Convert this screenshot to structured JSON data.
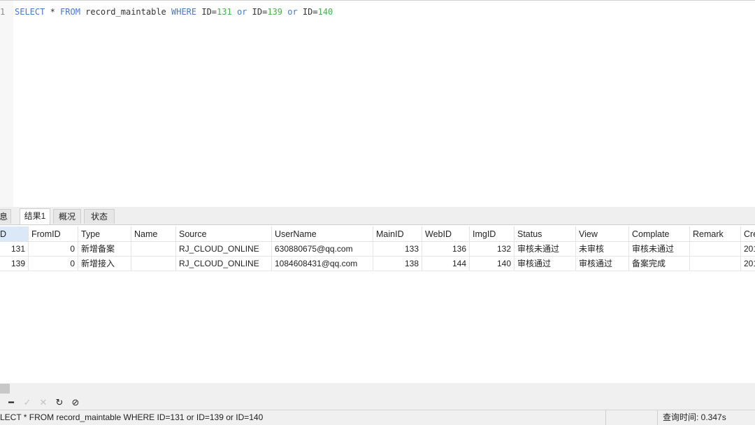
{
  "editor": {
    "line_number": "1",
    "sql": [
      {
        "text": "SELECT",
        "cls": "kw"
      },
      {
        "text": " * ",
        "cls": "txt"
      },
      {
        "text": "FROM",
        "cls": "kw"
      },
      {
        "text": " record_maintable ",
        "cls": "txt"
      },
      {
        "text": "WHERE",
        "cls": "kw"
      },
      {
        "text": " ID=",
        "cls": "txt"
      },
      {
        "text": "131",
        "cls": "num"
      },
      {
        "text": " ",
        "cls": "txt"
      },
      {
        "text": "or",
        "cls": "kw"
      },
      {
        "text": " ID=",
        "cls": "txt"
      },
      {
        "text": "139",
        "cls": "num"
      },
      {
        "text": " ",
        "cls": "txt"
      },
      {
        "text": "or",
        "cls": "kw"
      },
      {
        "text": " ID=",
        "cls": "txt"
      },
      {
        "text": "140",
        "cls": "num"
      }
    ],
    "colors": {
      "keyword": "#4a78c9",
      "number": "#4caf50",
      "text": "#333333"
    }
  },
  "tabs": [
    {
      "label": "息",
      "active": false
    },
    {
      "label": "结果1",
      "active": true
    },
    {
      "label": "概况",
      "active": false
    },
    {
      "label": "状态",
      "active": false
    }
  ],
  "grid": {
    "columns": [
      "D",
      "FromID",
      "Type",
      "Name",
      "Source",
      "UserName",
      "MainID",
      "WebID",
      "ImgID",
      "Status",
      "View",
      "Complate",
      "Remark",
      "Cre"
    ],
    "rows": [
      [
        "131",
        "0",
        "新增备案",
        "",
        "RJ_CLOUD_ONLINE",
        "630880675@qq.com",
        "133",
        "136",
        "132",
        "审核未通过",
        "未审核",
        "审核未通过",
        "",
        "201"
      ],
      [
        "139",
        "0",
        "新增接入",
        "",
        "RJ_CLOUD_ONLINE",
        "1084608431@qq.com",
        "138",
        "144",
        "140",
        "审核通过",
        "审核通过",
        "备案完成",
        "",
        "201"
      ]
    ],
    "selected_header_color": "#dbe8f8"
  },
  "toolbar": {
    "icons": [
      {
        "name": "delete-record-icon",
        "glyph": "━",
        "enabled": true
      },
      {
        "name": "apply-check-icon",
        "glyph": "✓",
        "enabled": false
      },
      {
        "name": "discard-x-icon",
        "glyph": "✕",
        "enabled": false
      },
      {
        "name": "refresh-icon",
        "glyph": "↻",
        "enabled": true
      },
      {
        "name": "stop-icon",
        "glyph": "⊘",
        "enabled": true
      }
    ]
  },
  "status": {
    "sql": "LECT * FROM record_maintable WHERE ID=131 or ID=139 or ID=140",
    "query_time": "查询时间: 0.347s"
  }
}
